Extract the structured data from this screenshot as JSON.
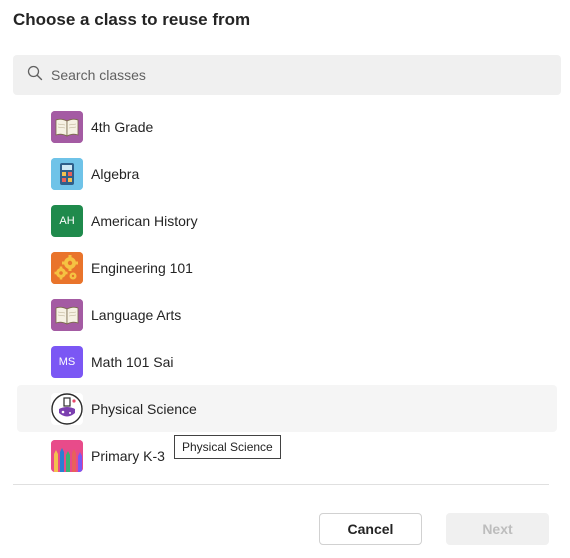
{
  "dialog": {
    "title": "Choose a class to reuse from"
  },
  "search": {
    "placeholder": "Search classes",
    "value": ""
  },
  "classes": [
    {
      "label": "4th Grade",
      "icon": "book-icon",
      "color": "#a45ba3"
    },
    {
      "label": "Algebra",
      "icon": "calculator-icon",
      "color": "#6fc3e8"
    },
    {
      "label": "American History",
      "icon": "initials",
      "initials": "AH",
      "color": "#1f8a4c"
    },
    {
      "label": "Engineering 101",
      "icon": "gears-icon",
      "color": "#e9742b"
    },
    {
      "label": "Language Arts",
      "icon": "book-icon",
      "color": "#a45ba3"
    },
    {
      "label": "Math 101 Sai",
      "icon": "initials",
      "initials": "MS",
      "color": "#7b57f4"
    },
    {
      "label": "Physical Science",
      "icon": "flask-icon",
      "color": "#ffffff",
      "hovered": true
    },
    {
      "label": "Primary K-3",
      "icon": "pencils-icon",
      "color": "#e84b8a"
    }
  ],
  "tooltip": {
    "text": "Physical Science"
  },
  "buttons": {
    "cancel": "Cancel",
    "next": "Next"
  }
}
